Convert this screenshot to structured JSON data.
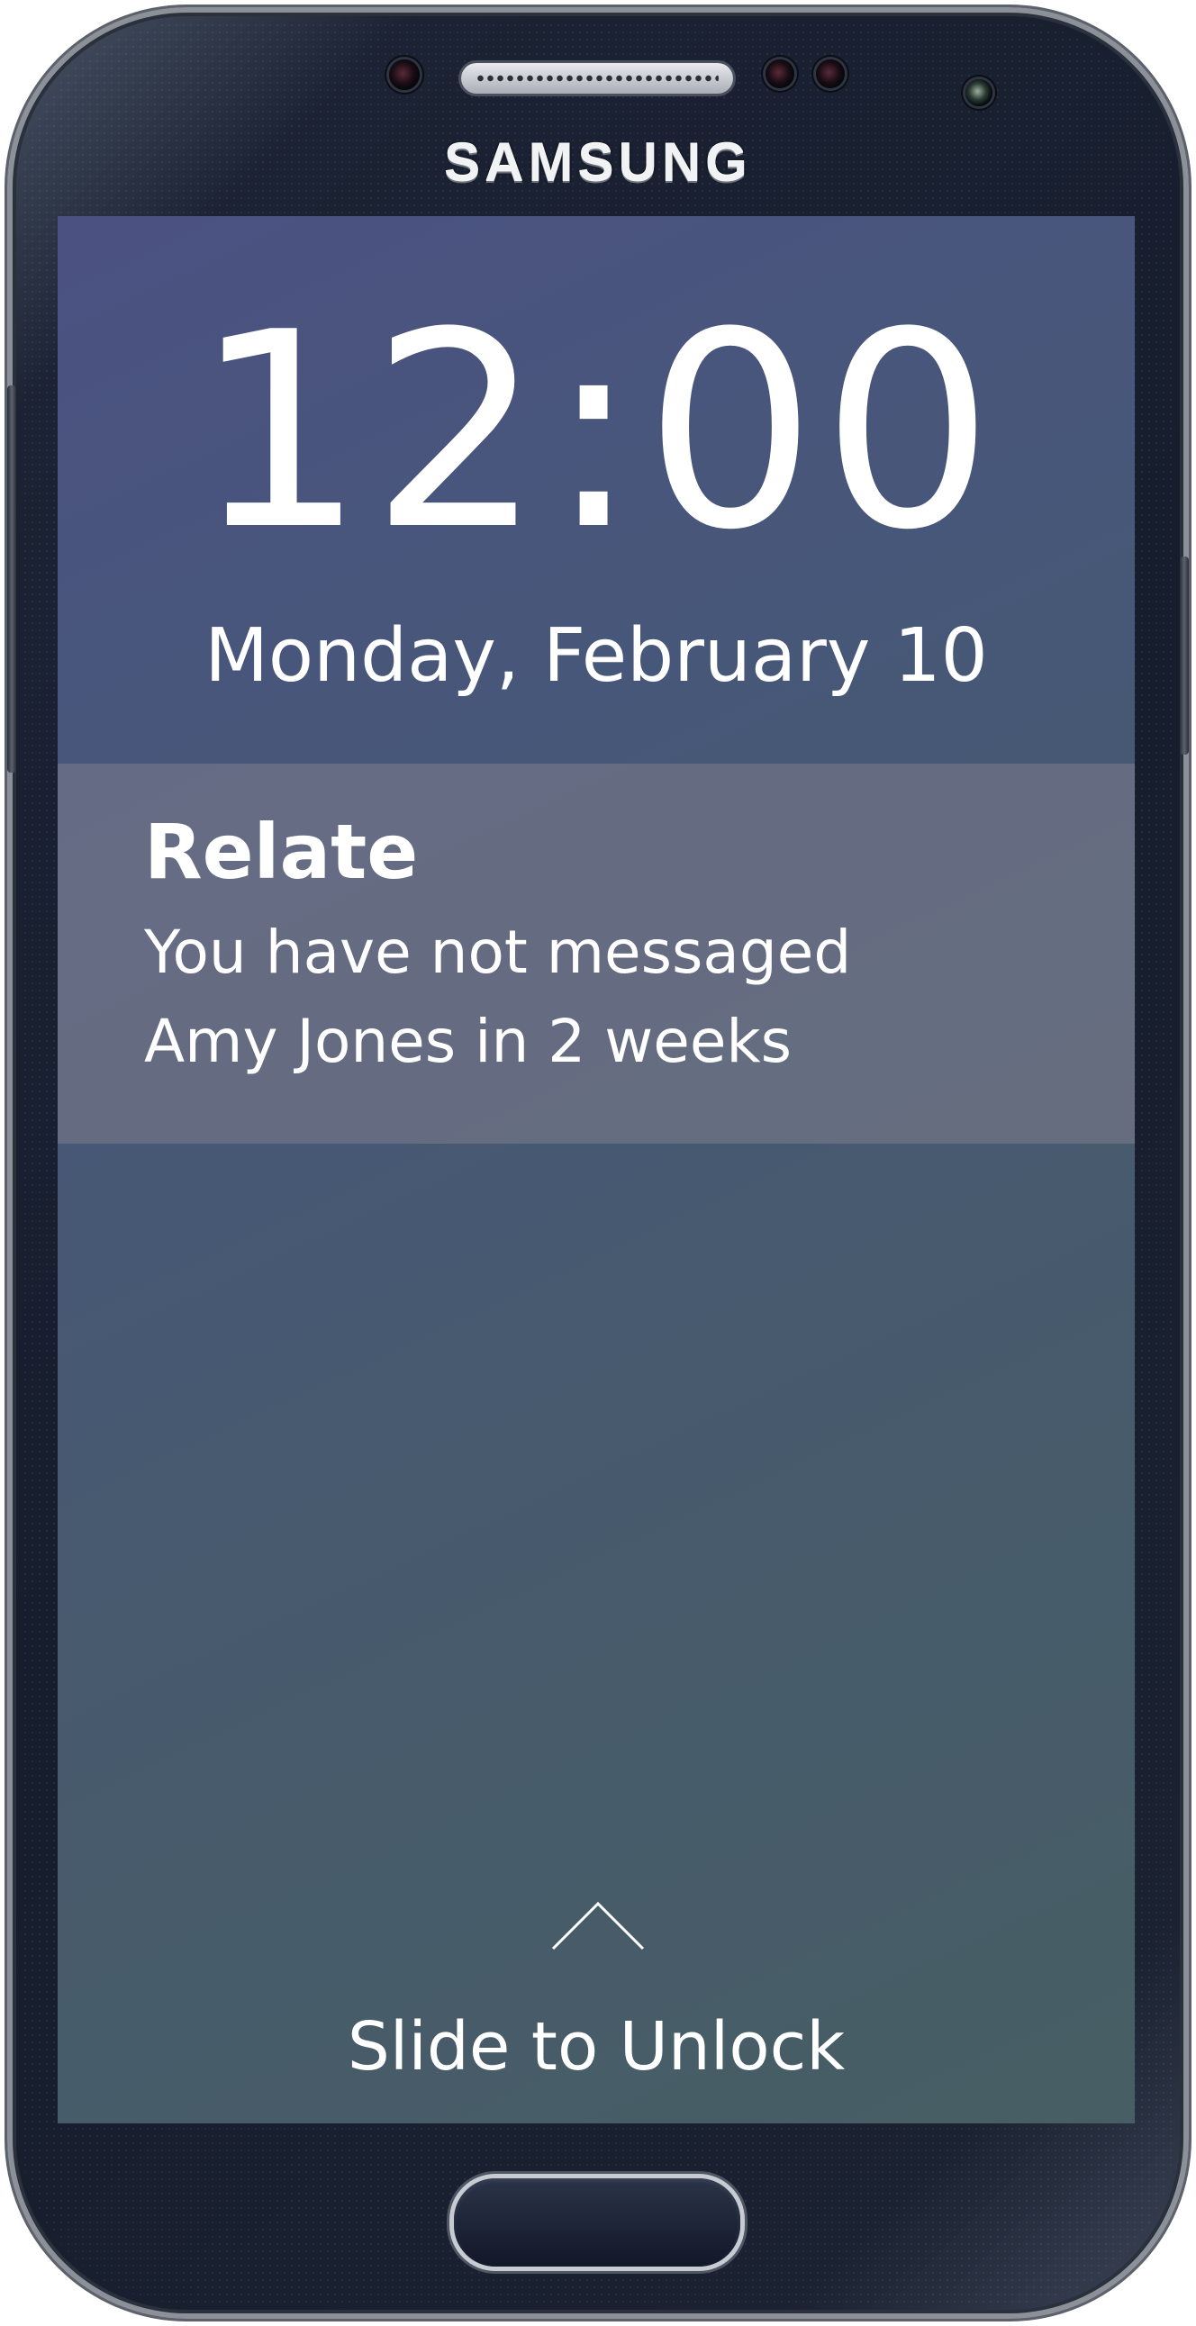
{
  "device": {
    "brand": "SAMSUNG"
  },
  "lockscreen": {
    "time": "12:00",
    "date": "Monday, February 10",
    "notification": {
      "app": "Relate",
      "message_line1": "You have not messaged",
      "message_line2": "Amy Jones in 2 weeks"
    },
    "unlock": {
      "icon": "chevron-up-icon",
      "label": "Slide to Unlock"
    }
  },
  "colors": {
    "screen_top": "#4b5282",
    "screen_bottom": "#475e64",
    "notification_bg": "#6e7384",
    "text": "#ffffff",
    "bezel": "#161d2d"
  }
}
